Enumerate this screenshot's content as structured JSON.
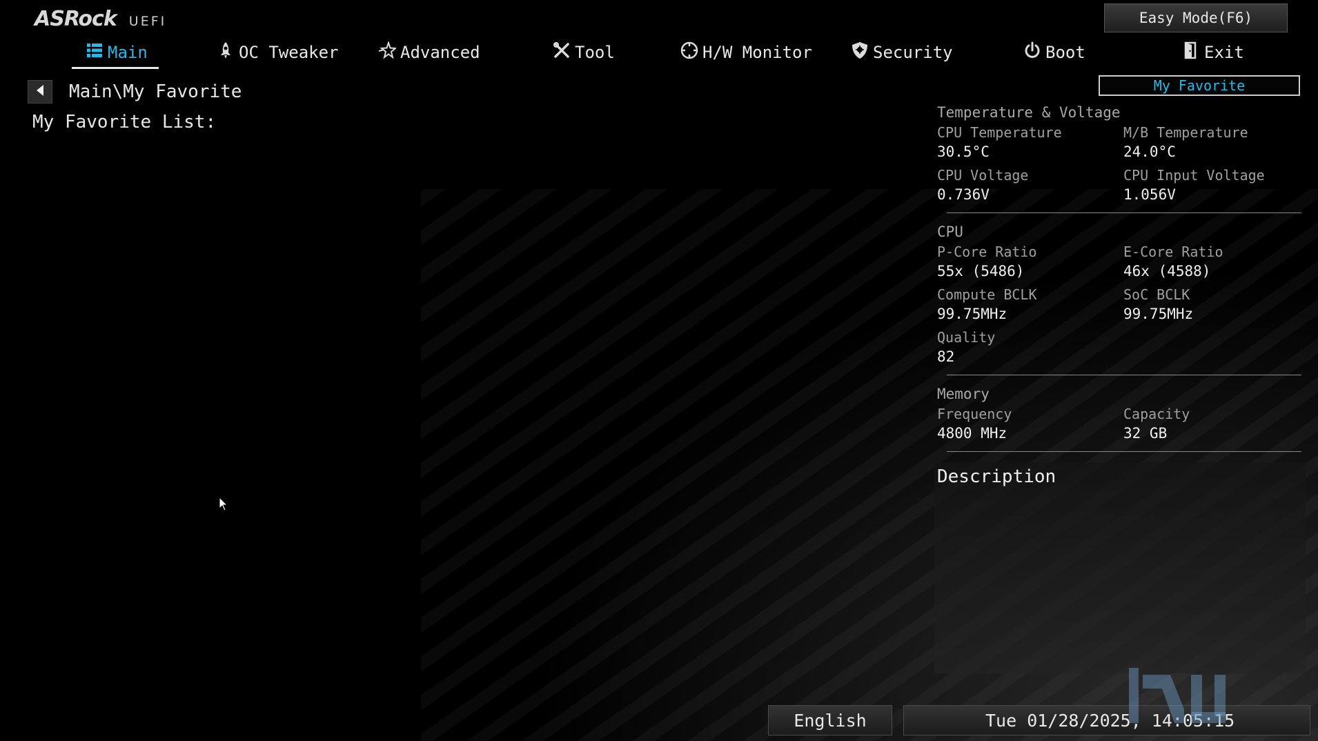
{
  "header": {
    "brand": "ASRock",
    "uefi": "UEFI",
    "easy_mode": "Easy Mode(F6)",
    "my_favorite": "My Favorite"
  },
  "tabs": [
    {
      "label": "Main",
      "icon": "list-icon",
      "active": true
    },
    {
      "label": "OC Tweaker",
      "icon": "rocket-icon"
    },
    {
      "label": "Advanced",
      "icon": "star-icon"
    },
    {
      "label": "Tool",
      "icon": "tools-icon"
    },
    {
      "label": "H/W Monitor",
      "icon": "monitor-gauge-icon"
    },
    {
      "label": "Security",
      "icon": "shield-icon"
    },
    {
      "label": "Boot",
      "icon": "power-icon"
    },
    {
      "label": "Exit",
      "icon": "exit-door-icon"
    }
  ],
  "main": {
    "breadcrumb": "Main\\My Favorite",
    "list_label": "My Favorite List:"
  },
  "panel": {
    "temp_voltage": {
      "title": "Temperature & Voltage",
      "items": [
        {
          "label": "CPU Temperature",
          "value": "30.5°C"
        },
        {
          "label": "M/B Temperature",
          "value": "24.0°C"
        },
        {
          "label": "CPU Voltage",
          "value": "0.736V"
        },
        {
          "label": "CPU Input Voltage",
          "value": "1.056V"
        }
      ]
    },
    "cpu": {
      "title": "CPU",
      "items": [
        {
          "label": "P-Core Ratio",
          "value": "55x (5486)"
        },
        {
          "label": "E-Core Ratio",
          "value": "46x (4588)"
        },
        {
          "label": "Compute BCLK",
          "value": "99.75MHz"
        },
        {
          "label": "SoC BCLK",
          "value": "99.75MHz"
        },
        {
          "label": "Quality",
          "value": "82"
        }
      ]
    },
    "memory": {
      "title": "Memory",
      "items": [
        {
          "label": "Frequency",
          "value": "4800 MHz"
        },
        {
          "label": "Capacity",
          "value": "32 GB"
        }
      ]
    }
  },
  "description": {
    "title": "Description"
  },
  "footer": {
    "language": "English",
    "datetime": "Tue 01/28/2025, 14:05:15"
  },
  "colors": {
    "accent": "#29b8e6",
    "background": "#000000"
  }
}
